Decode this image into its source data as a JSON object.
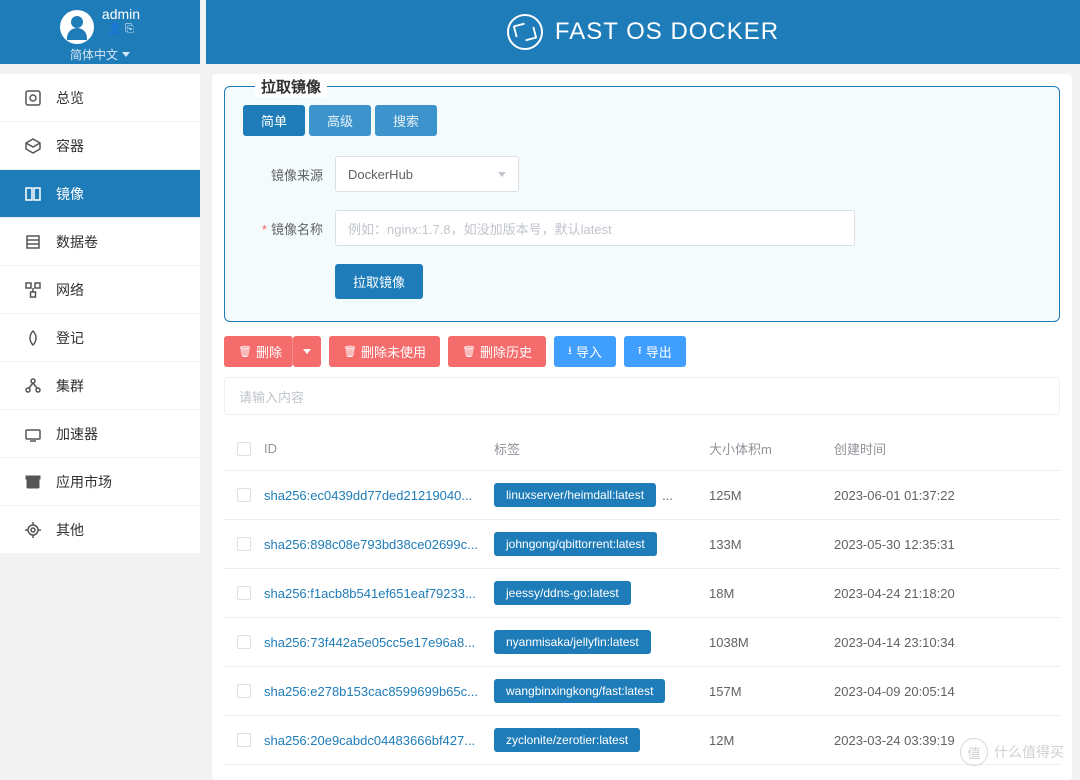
{
  "user": {
    "name": "admin",
    "lang": "简体中文"
  },
  "app": {
    "title": "FAST OS DOCKER"
  },
  "sidebar": [
    {
      "label": "总览"
    },
    {
      "label": "容器"
    },
    {
      "label": "镜像"
    },
    {
      "label": "数据卷"
    },
    {
      "label": "网络"
    },
    {
      "label": "登记"
    },
    {
      "label": "集群"
    },
    {
      "label": "加速器"
    },
    {
      "label": "应用市场"
    },
    {
      "label": "其他"
    }
  ],
  "panel": {
    "legend": "拉取镜像",
    "tabs": [
      "简单",
      "高级",
      "搜索"
    ],
    "source_label": "镜像来源",
    "source_value": "DockerHub",
    "name_label": "镜像名称",
    "name_placeholder": "例如：nginx:1.7.8，如没加版本号，默认latest",
    "submit": "拉取镜像"
  },
  "actions": {
    "delete": "删除",
    "delete_unused": "删除未使用",
    "delete_history": "删除历史",
    "import": "导入",
    "export": "导出"
  },
  "search_placeholder": "请输入内容",
  "table": {
    "headers": {
      "id": "ID",
      "tags": "标签",
      "size": "大小体积m",
      "time": "创建时间"
    },
    "rows": [
      {
        "id": "sha256:ec0439dd77ded21219040...",
        "tag": "linuxserver/heimdall:latest",
        "more": true,
        "size": "125M",
        "time": "2023-06-01 01:37:22"
      },
      {
        "id": "sha256:898c08e793bd38ce02699c...",
        "tag": "johngong/qbittorrent:latest",
        "more": false,
        "size": "133M",
        "time": "2023-05-30 12:35:31"
      },
      {
        "id": "sha256:f1acb8b541ef651eaf79233...",
        "tag": "jeessy/ddns-go:latest",
        "more": false,
        "size": "18M",
        "time": "2023-04-24 21:18:20"
      },
      {
        "id": "sha256:73f442a5e05cc5e17e96a8...",
        "tag": "nyanmisaka/jellyfin:latest",
        "more": false,
        "size": "1038M",
        "time": "2023-04-14 23:10:34"
      },
      {
        "id": "sha256:e278b153cac8599699b65c...",
        "tag": "wangbinxingkong/fast:latest",
        "more": false,
        "size": "157M",
        "time": "2023-04-09 20:05:14"
      },
      {
        "id": "sha256:20e9cabdc04483666bf427...",
        "tag": "zyclonite/zerotier:latest",
        "more": false,
        "size": "12M",
        "time": "2023-03-24 03:39:19"
      }
    ]
  },
  "watermark": "什么值得买"
}
